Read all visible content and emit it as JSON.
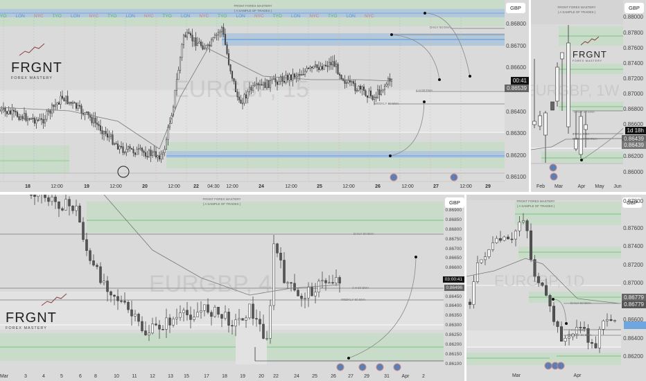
{
  "brand": {
    "name": "FRGNT",
    "tagline": "FOREX MASTERY",
    "header_title": "FRGNT FOREX MASTERY",
    "header_sub": "( A SAMPLE OF TRADES )"
  },
  "currency": "GBP",
  "ema_labels": {
    "daily": "DAILY 50 EMA",
    "h4": "4 H 50 EMA",
    "weekly": "WEEKLY 50 EMA"
  },
  "sessions": [
    "TYO",
    "LON",
    "NYC"
  ],
  "colors": {
    "zone_green": "#c8dcc9",
    "zone_blue": "#b4c8dc",
    "line_green": "#7cc47f",
    "line_blue": "#6fa6e0",
    "tyo": "#58b45a",
    "lon": "#5b8fd6",
    "nyc": "#d07a7a"
  },
  "panels": [
    {
      "watermark": "EURGBP, 15",
      "prices": [
        "0.86800",
        "0.86700",
        "0.86600",
        "0.86400",
        "0.86300",
        "0.86200",
        "0.86100"
      ],
      "countdown": "00:41",
      "last_price": "0.86539",
      "x_labels": [
        "18",
        "12:00",
        "19",
        "12:00",
        "20",
        "12:00",
        "22",
        "04:30",
        "12:00",
        "24",
        "12:00",
        "25",
        "12:00",
        "26",
        "12:00",
        "27",
        "12:00",
        "29"
      ]
    },
    {
      "watermark": "EURGBP, 1W",
      "prices": [
        "0.88000",
        "0.87800",
        "0.87600",
        "0.87400",
        "0.87200",
        "0.87000",
        "0.86800",
        "0.86600",
        "0.86200",
        "0.86000"
      ],
      "countdown": "1d 18h",
      "last_price": "0.86439",
      "last_price_2": "0.86439",
      "x_labels": [
        "Feb",
        "Mar",
        "Apr",
        "May",
        "Jun"
      ]
    },
    {
      "watermark": "EURGBP, 4",
      "prices": [
        "0.86900",
        "0.86850",
        "0.86800",
        "0.86750",
        "0.86700",
        "0.86650",
        "0.86600",
        "0.86450",
        "0.86400",
        "0.86350",
        "0.86300",
        "0.86250",
        "0.86200",
        "0.86150",
        "0.86100"
      ],
      "countdown": "03:00:41",
      "last_price": "0.86496",
      "x_labels": [
        "Mar",
        "3",
        "4",
        "5",
        "6",
        "8",
        "10",
        "11",
        "12",
        "13",
        "15",
        "17",
        "18",
        "19",
        "20",
        "22",
        "24",
        "25",
        "26",
        "27",
        "29",
        "31",
        "Apr",
        "2"
      ]
    },
    {
      "watermark": "EURGBP, 1D",
      "prices": [
        "0.87800",
        "0.87600",
        "0.87400",
        "0.87200",
        "0.87000",
        "0.86600",
        "0.86400",
        "0.86200"
      ],
      "last_price": "0.86779",
      "last_price_2": "0.86779",
      "x_labels": [
        "Mar",
        "Apr"
      ]
    }
  ]
}
